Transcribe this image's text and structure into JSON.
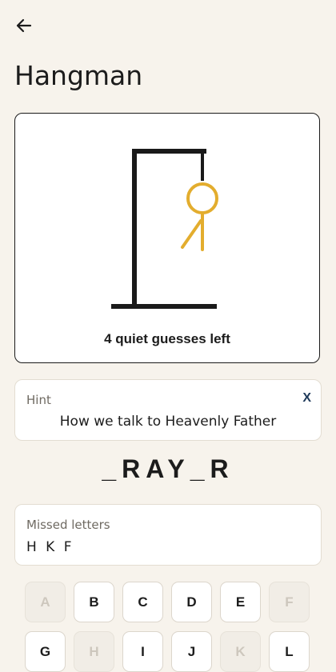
{
  "header": {
    "back_icon": "arrow-left-icon",
    "title": "Hangman"
  },
  "game": {
    "guesses_left_text": "4 quiet guesses left",
    "figure_color": "#e3ad2e",
    "gallows_color": "#1a1a1a"
  },
  "hint": {
    "label": "Hint",
    "close_label": "X",
    "text": "How we talk to Heavenly Father"
  },
  "word": {
    "display": "_RAY_R"
  },
  "missed": {
    "label": "Missed letters",
    "letters": "H K F"
  },
  "keyboard": {
    "keys": [
      {
        "letter": "A",
        "disabled": true
      },
      {
        "letter": "B",
        "disabled": false
      },
      {
        "letter": "C",
        "disabled": false
      },
      {
        "letter": "D",
        "disabled": false
      },
      {
        "letter": "E",
        "disabled": false
      },
      {
        "letter": "F",
        "disabled": true
      },
      {
        "letter": "G",
        "disabled": false
      },
      {
        "letter": "H",
        "disabled": true
      },
      {
        "letter": "I",
        "disabled": false
      },
      {
        "letter": "J",
        "disabled": false
      },
      {
        "letter": "K",
        "disabled": true
      },
      {
        "letter": "L",
        "disabled": false
      }
    ]
  }
}
